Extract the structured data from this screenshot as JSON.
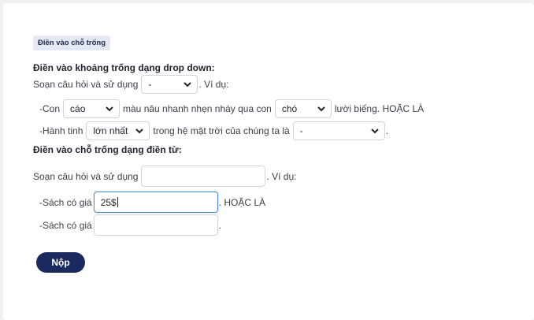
{
  "tag": "Điền vào chỗ trống",
  "dropdown_section": {
    "heading": "Điền vào khoảng trống dạng drop down:",
    "intro_text": "Soạn câu hỏi và sử dụng",
    "intro_select": "-",
    "intro_suffix": ". Ví dụ:",
    "example1": {
      "prefix": "-Con",
      "select1": "cáo",
      "middle": "màu nâu nhanh nhẹn nháy qua con",
      "select2": "chó",
      "suffix": "lười biếng. HOẶC LÀ"
    },
    "example2": {
      "prefix": "-Hành tinh",
      "select1": "lớn nhất",
      "middle": "trong hệ mặt trời của chúng ta là",
      "select2": "-",
      "suffix": "."
    }
  },
  "text_section": {
    "heading": "Điền vào chỗ trống dạng điền từ:",
    "intro_text": "Soạn câu hỏi và sử dụng",
    "intro_input": "",
    "intro_suffix": ". Ví dụ:",
    "example1": {
      "prefix": "-Sách có giá",
      "input": "25$",
      "suffix": ". HOẶC LÀ"
    },
    "example2": {
      "prefix": "-Sách có giá",
      "input": "",
      "suffix": "."
    }
  },
  "submit_label": "Nộp",
  "colors": {
    "button": "#1b2a5e",
    "tag_bg": "#e4e9f4",
    "focus_border": "#4d8cd9"
  }
}
